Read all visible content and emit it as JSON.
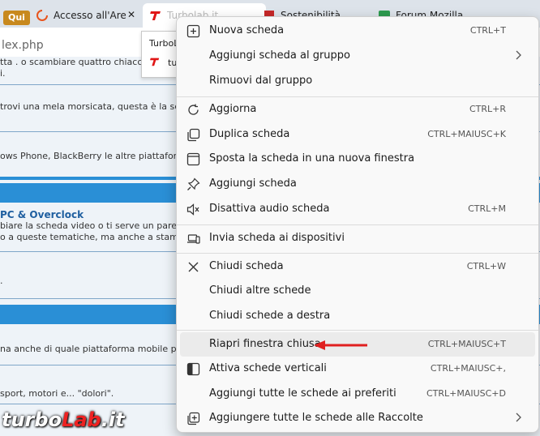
{
  "browser": {
    "tabs": [
      {
        "label": "Qui",
        "kind": "pill"
      },
      {
        "label": "Accesso all'Are",
        "icon": "loading-icon"
      },
      {
        "label": "Turbolab.it",
        "icon": "turbolab-icon"
      },
      {
        "label": "Sostenibilità",
        "icon": "red-square-icon"
      },
      {
        "label": "Forum Mozilla",
        "icon": "green-square-icon"
      }
    ],
    "close_glyph": "✕",
    "address": "lex.php",
    "tooltip": {
      "title": "TurboL",
      "site": "tu"
    }
  },
  "page": {
    "rows": [
      "tta . o scambiare quattro chiacchi",
      "i.",
      "trovi una mela morsicata, questa è la se",
      "ows Phone, BlackBerry le altre piattaform",
      "biare la scheda video o ti serve un parer",
      "o a queste tematiche, ma anche a stampa",
      ".",
      "na anche di quale piattaforma mobile pref",
      "sport, motori e... \"dolori\"."
    ],
    "heading": "PC & Overclock",
    "logo": {
      "main": "turbo",
      "accent": "Lab",
      "suffix": ".it"
    }
  },
  "menu": {
    "items": [
      {
        "label": "Nuova scheda",
        "shortcut": "CTRL+T",
        "icon": "new-tab-icon"
      },
      {
        "label": "Aggiungi scheda al gruppo",
        "shortcut": "",
        "icon": "",
        "submenu": true
      },
      {
        "label": "Rimuovi dal gruppo",
        "shortcut": "",
        "icon": ""
      },
      {
        "label": "Aggiorna",
        "shortcut": "CTRL+R",
        "icon": "refresh-icon"
      },
      {
        "label": "Duplica scheda",
        "shortcut": "CTRL+MAIUSC+K",
        "icon": "duplicate-icon"
      },
      {
        "label": "Sposta la scheda in una nuova finestra",
        "shortcut": "",
        "icon": "window-icon"
      },
      {
        "label": "Aggiungi scheda",
        "shortcut": "",
        "icon": "pin-icon"
      },
      {
        "label": "Disattiva audio scheda",
        "shortcut": "CTRL+M",
        "icon": "mute-icon"
      },
      {
        "label": "Invia scheda ai dispositivi",
        "shortcut": "",
        "icon": "devices-icon"
      },
      {
        "label": "Chiudi scheda",
        "shortcut": "CTRL+W",
        "icon": "close-icon"
      },
      {
        "label": "Chiudi altre schede",
        "shortcut": "",
        "icon": ""
      },
      {
        "label": "Chiudi schede a destra",
        "shortcut": "",
        "icon": ""
      },
      {
        "label": "Riapri finestra chiusa",
        "shortcut": "CTRL+MAIUSC+T",
        "icon": "",
        "highlighted": true
      },
      {
        "label": "Attiva schede verticali",
        "shortcut": "CTRL+MAIUSC+,",
        "icon": "vertical-tabs-icon"
      },
      {
        "label": "Aggiungi tutte le schede ai preferiti",
        "shortcut": "CTRL+MAIUSC+D",
        "icon": ""
      },
      {
        "label": "Aggiungere tutte le schede alle Raccolte",
        "shortcut": "",
        "icon": "collections-icon",
        "submenu": true
      }
    ]
  },
  "colors": {
    "accent_band": "#2a8fd6",
    "annotation_arrow": "#e02020",
    "pill": "#c8891e"
  }
}
